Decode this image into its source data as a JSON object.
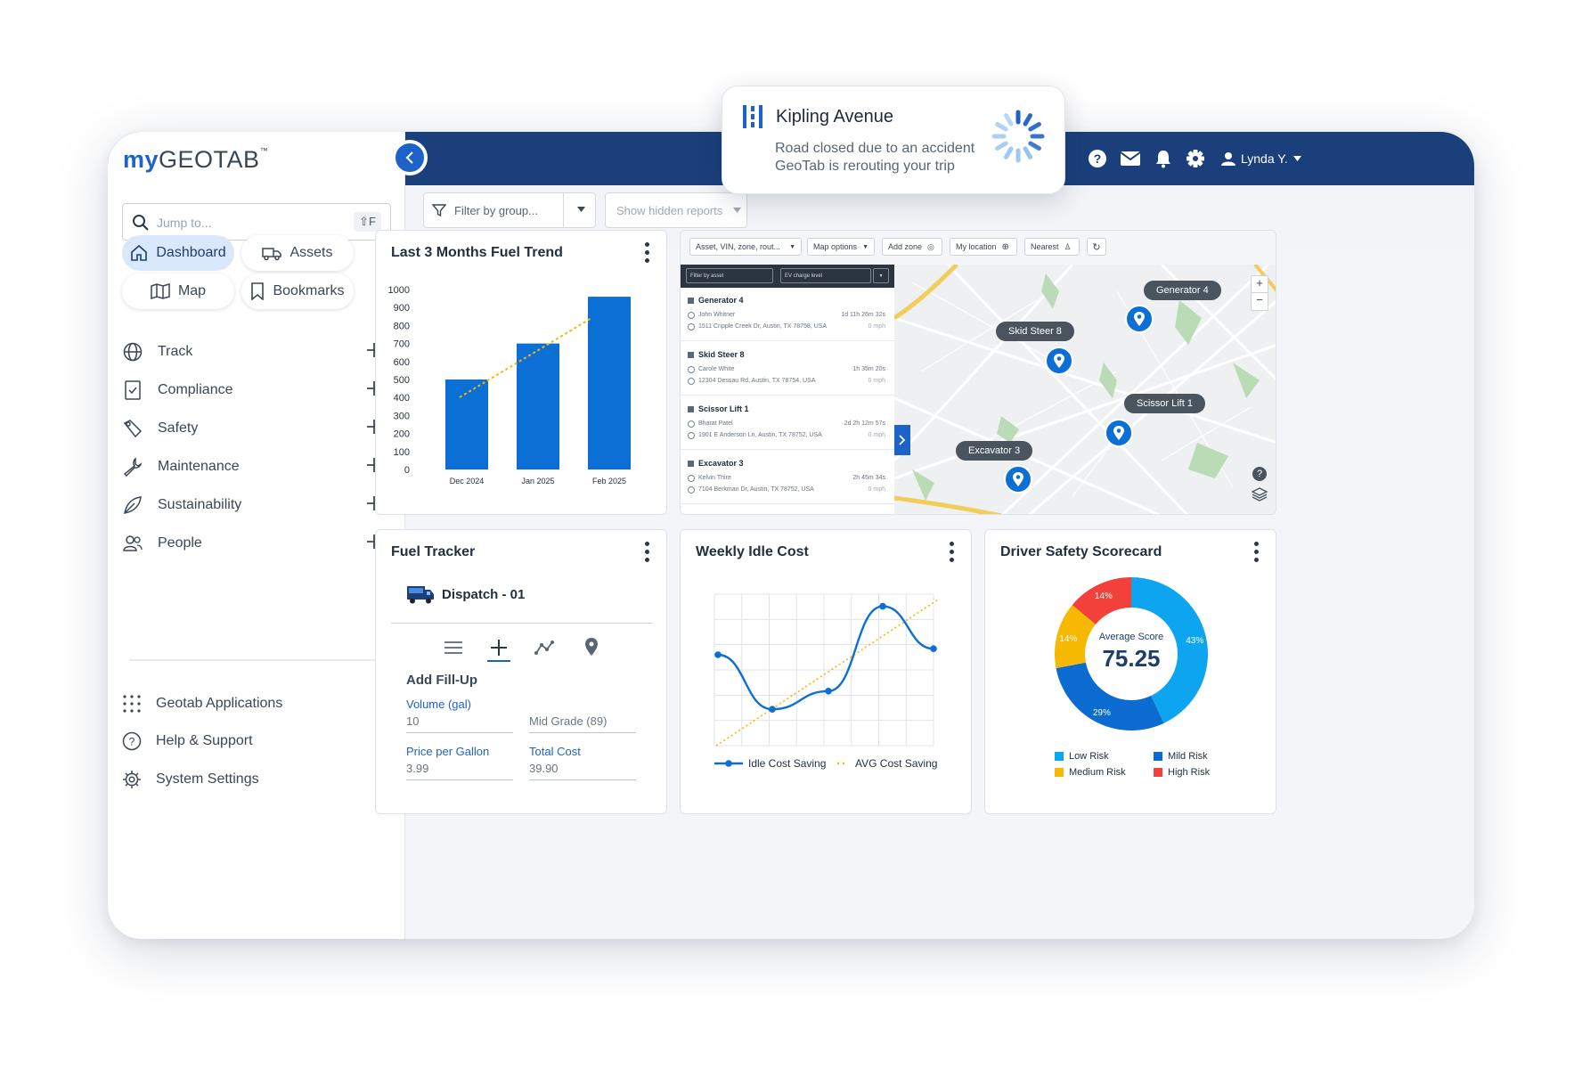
{
  "brand": {
    "my": "my",
    "geotab": "GEOTAB",
    "tm": "™"
  },
  "search": {
    "placeholder": "Jump to...",
    "shortcut": "⇧F"
  },
  "quick_nav": [
    {
      "label": "Dashboard",
      "icon": "home-icon"
    },
    {
      "label": "Assets",
      "icon": "truck-icon"
    },
    {
      "label": "Map",
      "icon": "map-icon"
    },
    {
      "label": "Bookmarks",
      "icon": "bookmark-icon"
    }
  ],
  "nav": [
    {
      "label": "Track",
      "icon": "globe-icon"
    },
    {
      "label": "Compliance",
      "icon": "compliance-icon"
    },
    {
      "label": "Safety",
      "icon": "safety-icon"
    },
    {
      "label": "Maintenance",
      "icon": "wrench-icon"
    },
    {
      "label": "Sustainability",
      "icon": "leaf-icon"
    },
    {
      "label": "People",
      "icon": "people-icon"
    }
  ],
  "footer_nav": [
    {
      "label": "Geotab Applications",
      "icon": "apps-grid-icon"
    },
    {
      "label": "Help & Support",
      "icon": "help-icon"
    },
    {
      "label": "System Settings",
      "icon": "settings-icon"
    }
  ],
  "topbar": {
    "user": "Lynda Y."
  },
  "toolbar": {
    "filter_placeholder": "Filter by group...",
    "hidden_reports": "Show hidden reports"
  },
  "notification": {
    "title": "Kipling Avenue",
    "line1": "Road closed due to an accident",
    "line2": "GeoTab is rerouting your trip"
  },
  "fuel_trend": {
    "title": "Last 3 Months Fuel Trend"
  },
  "map_panel": {
    "toolbar": [
      "Asset, VIN, zone, rout...",
      "Map options",
      "Add zone",
      "My location",
      "Nearest"
    ],
    "list_filter": "Filter by asset",
    "list_filter2": "EV charge level",
    "assets": [
      {
        "name": "Generator 4",
        "driver": "John Whitner",
        "address": "1511 Cripple Creek Dr, Austin, TX 78758, USA",
        "time": "1d 11h 26m 32s",
        "speed": "0 mph"
      },
      {
        "name": "Skid Steer 8",
        "driver": "Carole White",
        "address": "12304 Dessau Rd, Austin, TX 78754, USA",
        "time": "1h 35m 20s",
        "speed": "0 mph"
      },
      {
        "name": "Scissor Lift 1",
        "driver": "Bharat Patel",
        "address": "1901 E Anderson Ln, Austin, TX 78752, USA",
        "time": "2d 2h 12m 57s",
        "speed": "0 mph"
      },
      {
        "name": "Excavator 3",
        "driver": "Kelvin Thire",
        "address": "7104 Berkman Dr, Austin, TX 78752, USA",
        "time": "2h 45m 34s",
        "speed": "0 mph"
      }
    ],
    "labels": [
      "Generator 4",
      "Skid Steer 8",
      "Scissor Lift 1",
      "Excavator 3"
    ],
    "zoom_in": "+",
    "zoom_out": "−",
    "help": "?"
  },
  "fuel_tracker": {
    "title": "Fuel Tracker",
    "vehicle": "Dispatch - 01",
    "section": "Add Fill-Up",
    "volume_label": "Volume (gal)",
    "volume_value": "10",
    "grade_value": "Mid Grade (89)",
    "price_label": "Price per Gallon",
    "price_value": "3.99",
    "total_label": "Total Cost",
    "total_value": "39.90"
  },
  "idle_cost": {
    "title": "Weekly Idle Cost"
  },
  "safety": {
    "title": "Driver Safety Scorecard",
    "avg_label": "Average Score",
    "avg_value": "75.25",
    "legend": [
      {
        "label": "Low Risk",
        "color": "#0ea5f0"
      },
      {
        "label": "Mild Risk",
        "color": "#0b6bd0"
      },
      {
        "label": "Medium Risk",
        "color": "#f6b800"
      },
      {
        "label": "High Risk",
        "color": "#f2413a"
      }
    ]
  },
  "chart_data": [
    {
      "type": "bar",
      "title": "Last 3 Months Fuel Trend",
      "categories": [
        "Dec 2024",
        "Jan 2025",
        "Feb 2025"
      ],
      "values": [
        500,
        700,
        960
      ],
      "ylim": [
        0,
        1000
      ],
      "yticks": [
        0,
        100,
        200,
        300,
        400,
        500,
        600,
        700,
        800,
        900,
        1000
      ],
      "trendline": true,
      "colors": {
        "bar": "#0b6fd6",
        "trend": "#f6b800"
      }
    },
    {
      "type": "line",
      "title": "Weekly Idle Cost",
      "series": [
        {
          "name": "Idle Cost Saving",
          "values": [
            7.5,
            3.0,
            4.5,
            11.5,
            8.0
          ]
        },
        {
          "name": "AVG Cost Saving",
          "values": [
            0,
            12
          ]
        }
      ],
      "grid": true,
      "colors": {
        "idle": "#0b6fd6",
        "avg": "#f6b800"
      }
    },
    {
      "type": "pie",
      "title": "Driver Safety Scorecard",
      "categories": [
        "Low Risk",
        "Mild Risk",
        "Medium Risk",
        "High Risk"
      ],
      "values": [
        43,
        29,
        14,
        14
      ],
      "labels": [
        "43%",
        "29%",
        "14%",
        "14%"
      ]
    }
  ]
}
